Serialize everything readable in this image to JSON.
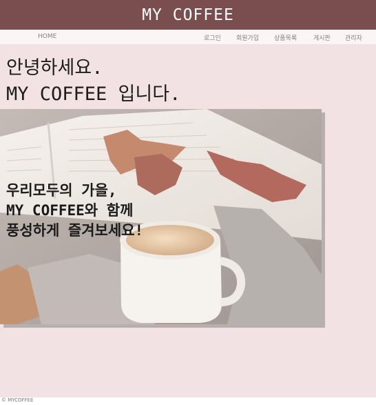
{
  "header": {
    "title": "MY COFFEE"
  },
  "nav": {
    "home": "HOME",
    "items": [
      "로그인",
      "회원가입",
      "상품목록",
      "게시판",
      "관리자"
    ]
  },
  "main": {
    "greeting": [
      "안녕하세요.",
      "MY COFFEE 입니다."
    ],
    "hero_text": [
      "우리모두의 가을,",
      "MY COFFEE와 함께",
      "풍성하게 즐겨보세요!"
    ]
  },
  "footer": {
    "text": "© MYCOFFEE"
  },
  "colors": {
    "header_bg": "#7a4e4e",
    "page_bg": "#f3e2e3",
    "nav_bg": "#fbf6f6"
  }
}
